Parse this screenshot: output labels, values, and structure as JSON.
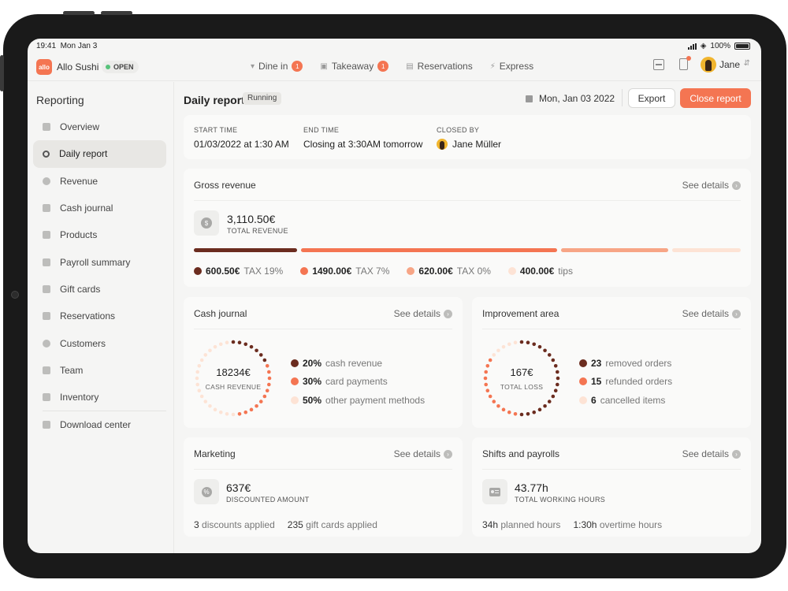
{
  "status_bar": {
    "time": "19:41",
    "date": "Mon Jan 3",
    "battery": "100%"
  },
  "topbar": {
    "logo_text": "allo",
    "brand": "Allo Sushi",
    "open_label": "OPEN",
    "nav": [
      {
        "label": "Dine in",
        "count": "1",
        "icon": "fork-knife-icon"
      },
      {
        "label": "Takeaway",
        "count": "1",
        "icon": "bag-icon"
      },
      {
        "label": "Reservations",
        "count": "",
        "icon": "book-icon"
      },
      {
        "label": "Express",
        "count": "",
        "icon": "bolt-icon"
      }
    ],
    "user": "Jane"
  },
  "sidebar": {
    "title": "Reporting",
    "items": [
      {
        "label": "Overview",
        "icon": "bar-chart-icon"
      },
      {
        "label": "Daily report",
        "icon": "sun-icon",
        "active": true
      },
      {
        "label": "Revenue",
        "icon": "coin-icon"
      },
      {
        "label": "Cash journal",
        "icon": "journal-icon"
      },
      {
        "label": "Products",
        "icon": "bowl-icon"
      },
      {
        "label": "Payroll summary",
        "icon": "document-icon"
      },
      {
        "label": "Gift cards",
        "icon": "gift-icon"
      },
      {
        "label": "Reservations",
        "icon": "book-icon"
      },
      {
        "label": "Customers",
        "icon": "person-icon"
      },
      {
        "label": "Team",
        "icon": "id-card-icon"
      },
      {
        "label": "Inventory",
        "icon": "box-icon"
      },
      {
        "label": "Download center",
        "icon": "download-icon"
      }
    ]
  },
  "header": {
    "title": "Daily report",
    "status": "Running",
    "date": "Mon, Jan 03 2022",
    "export_label": "Export",
    "close_label": "Close report"
  },
  "info": {
    "start_label": "START TIME",
    "start_value": "01/03/2022 at 1:30 AM",
    "end_label": "END TIME",
    "end_value": "Closing at 3:30AM tomorrow",
    "closed_label": "CLOSED BY",
    "closed_value": "Jane Müller"
  },
  "see_details": "See details",
  "gross": {
    "title": "Gross revenue",
    "value": "3,110.50€",
    "label": "TOTAL REVENUE",
    "segments": [
      {
        "value": "600.50€",
        "label": "TAX 19%",
        "amount": 600.5,
        "color": "#6b2c1f"
      },
      {
        "value": "1490.00€",
        "label": "TAX 7%",
        "amount": 1490,
        "color": "#f47552"
      },
      {
        "value": "620.00€",
        "label": "TAX 0%",
        "amount": 620,
        "color": "#f7a586"
      },
      {
        "value": "400.00€",
        "label": "tips",
        "amount": 400,
        "color": "#fde3d5"
      }
    ]
  },
  "cash": {
    "title": "Cash journal",
    "value": "18234€",
    "label": "CASH REVENUE",
    "stats": [
      {
        "pct": "20%",
        "label": "cash revenue",
        "share": 20,
        "color": "#6b2c1f"
      },
      {
        "pct": "30%",
        "label": "card payments",
        "share": 30,
        "color": "#f47552"
      },
      {
        "pct": "50%",
        "label": "other payment methods",
        "share": 50,
        "color": "#fde3d5"
      }
    ]
  },
  "improvement": {
    "title": "Improvement area",
    "value": "167€",
    "label": "TOTAL LOSS",
    "stats": [
      {
        "num": "23",
        "label": "removed orders",
        "share": 52,
        "color": "#6b2c1f"
      },
      {
        "num": "15",
        "label": "refunded orders",
        "share": 34,
        "color": "#f47552"
      },
      {
        "num": "6",
        "label": "cancelled items",
        "share": 14,
        "color": "#fde3d5"
      }
    ]
  },
  "marketing": {
    "title": "Marketing",
    "value": "637€",
    "label": "DISCOUNTED AMOUNT",
    "a_num": "3",
    "a_text": "discounts applied",
    "b_num": "235",
    "b_text": "gift cards applied"
  },
  "shifts": {
    "title": "Shifts and payrolls",
    "value": "43.77h",
    "label": "TOTAL WORKING HOURS",
    "a_num": "34h",
    "a_text": "planned hours",
    "b_num": "1:30h",
    "b_text": "overtime hours"
  }
}
